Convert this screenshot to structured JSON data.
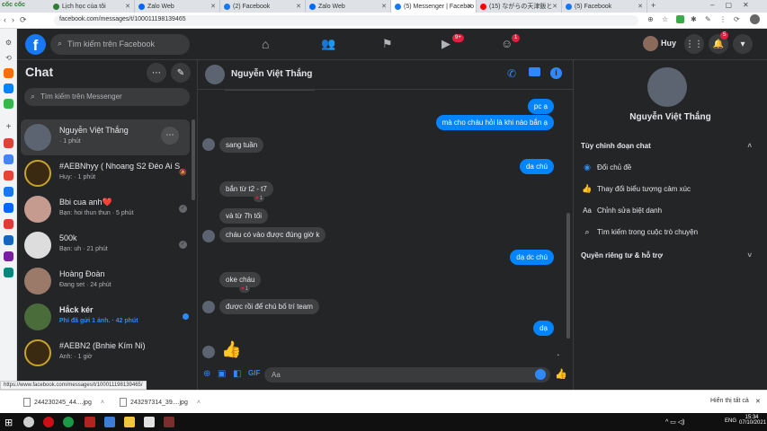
{
  "browser": {
    "tabs": [
      {
        "label": "Lịch học của tôi",
        "color": "#2e7d32"
      },
      {
        "label": "Zalo Web",
        "color": "#0068ff"
      },
      {
        "label": "(2) Facebook",
        "color": "#1877f2"
      },
      {
        "label": "Zalo Web",
        "color": "#0068ff"
      },
      {
        "label": "(5) Messenger | Faceboo",
        "color": "#1877f2"
      },
      {
        "label": "(15) ながらの天津飯と",
        "color": "#ff0000"
      },
      {
        "label": "(5) Facebook",
        "color": "#1877f2"
      }
    ],
    "browser_name": "cốc cốc",
    "url": "facebook.com/messages/t/100011198139465",
    "status_url": "https://www.facebook.com/messages/t/100011198139465/"
  },
  "fb": {
    "search_placeholder": "Tìm kiếm trên Facebook",
    "user_name": "Huy",
    "watch_badge": "9+",
    "groups_badge": "1",
    "notif_badge": "5"
  },
  "chatlist": {
    "title": "Chat",
    "search_placeholder": "Tìm kiếm trên Messenger",
    "items": [
      {
        "name": "Nguyễn Việt Thắng",
        "sub": "· 1 phút",
        "avatar": "#5b6470"
      },
      {
        "name": "#AEBNhyy ( Nhoang S2 Đéo Ai S1)",
        "sub": "Huy: · 1 phút",
        "avatar": "#3b2a12"
      },
      {
        "name": "Bbi cua anh❤️",
        "sub": "Bạn: hoi thun thun · 5 phút",
        "avatar": "#c59a8f"
      },
      {
        "name": "500k",
        "sub": "Bạn: uh · 21 phút",
        "avatar": "#dddddd"
      },
      {
        "name": "Hoàng Đoàn",
        "sub": "Đang set · 24 phút",
        "avatar": "#9c7a6a"
      },
      {
        "name": "Hắck kér",
        "sub": "Phí đã gửi 1 ảnh. · 42 phút",
        "avatar": "#4a6b3a"
      },
      {
        "name": "#AEBN2 (Bnhie Kím Ni)",
        "sub": "Anh: · 1 giờ",
        "avatar": "#3b2a12"
      }
    ]
  },
  "conversation": {
    "contact": "Nguyễn Việt Thắng",
    "input_placeholder": "Aa",
    "messages": [
      {
        "dir": "out",
        "text": "pc ạ"
      },
      {
        "dir": "out",
        "text": "mà cho cháu hỏi là khi nào bắn ạ"
      },
      {
        "dir": "in",
        "text": "sang tuần"
      },
      {
        "dir": "out",
        "text": "da chú"
      },
      {
        "dir": "in",
        "text": "bắn từ t2 - t7",
        "react": "1"
      },
      {
        "dir": "in",
        "text": "và từ 7h tối"
      },
      {
        "dir": "in",
        "text": "cháu có vào được đúng giờ k"
      },
      {
        "dir": "out",
        "text": "dạ dc chú"
      },
      {
        "dir": "in",
        "text": "oke cháu",
        "react": "1"
      },
      {
        "dir": "in",
        "text": "được rồi để chú bố trí team"
      },
      {
        "dir": "out",
        "text": "dạ"
      }
    ]
  },
  "info_panel": {
    "name": "Nguyễn Việt Thắng",
    "section_customize": "Tùy chỉnh đoạn chat",
    "change_theme": "Đổi chủ đề",
    "change_emoji": "Thay đổi biểu tượng cảm xúc",
    "edit_nicknames": "Chỉnh sửa biệt danh",
    "search_conv": "Tìm kiếm trong cuộc trò chuyện",
    "section_privacy": "Quyền riêng tư & hỗ trợ"
  },
  "downloads": {
    "file1": "244230245_44....jpg",
    "file2": "243297314_39....jpg",
    "show_all": "Hiển thị tất cả"
  },
  "taskbar": {
    "lang": "ENG",
    "time": "15:34",
    "date": "07/10/2021"
  }
}
